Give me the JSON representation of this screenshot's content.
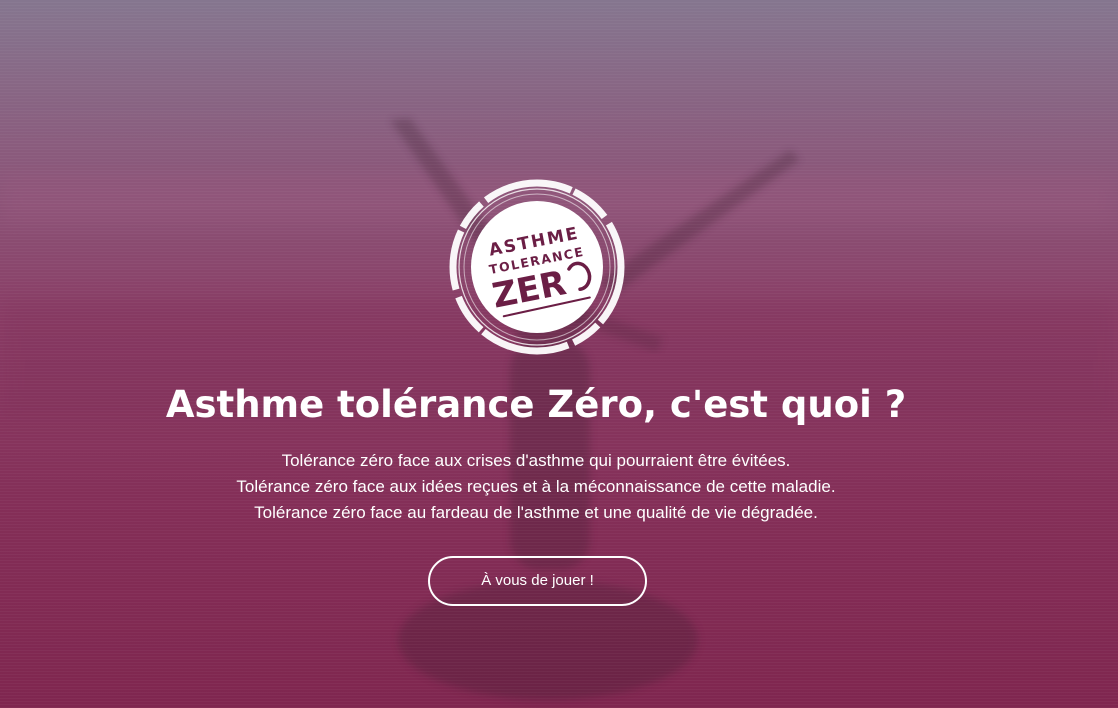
{
  "hero": {
    "logo": {
      "line1": "ASTHME",
      "line2": "TOLERANCE",
      "line3": "ZER"
    },
    "title": "Asthme tolérance Zéro, c'est quoi ?",
    "lines": [
      "Tolérance zéro face aux crises d'asthme qui pourraient être évitées.",
      "Tolérance zéro face aux idées reçues et à la méconnaissance de cette maladie.",
      "Tolérance zéro face au fardeau de l'asthme et une qualité de vie dégradée."
    ],
    "cta_label": "À vous de jouer !"
  },
  "colors": {
    "overlay_top": "#85768f",
    "overlay_bottom": "#7f264f",
    "logo_text": "#6b1e45",
    "text": "#ffffff"
  }
}
